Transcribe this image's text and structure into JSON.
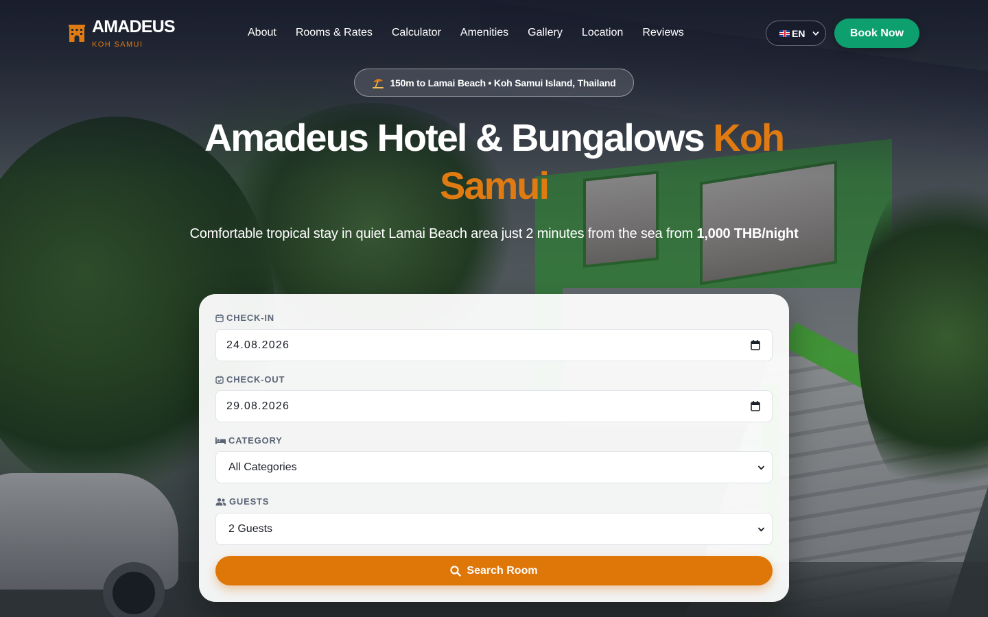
{
  "header": {
    "logo_name": "AMADEUS",
    "logo_sub": "KOH SAMUI",
    "nav": [
      "About",
      "Rooms & Rates",
      "Calculator",
      "Amenities",
      "Gallery",
      "Location",
      "Reviews"
    ],
    "language": "EN",
    "book_now": "Book Now"
  },
  "hero": {
    "location_badge": "150m to Lamai Beach • Koh Samui Island, Thailand",
    "title_main": "Amadeus Hotel & Bungalows",
    "title_accent": "Koh Samui",
    "subtitle_text": "Comfortable tropical stay in quiet Lamai Beach area just 2 minutes from the sea from",
    "subtitle_price": "1,000 THB/night"
  },
  "booking": {
    "checkin_label": "CHECK-IN",
    "checkin_value": "24.08.2026",
    "checkout_label": "CHECK-OUT",
    "checkout_value": "29.08.2026",
    "category_label": "CATEGORY",
    "category_value": "All Categories",
    "guests_label": "GUESTS",
    "guests_value": "2 Guests",
    "search_label": "Search Room"
  },
  "colors": {
    "accent": "#e07b12",
    "book_button": "#0e9f6e",
    "search_button": "#df7608"
  },
  "icons": {
    "logo": "hotel-building-icon",
    "badge": "beach-umbrella-icon",
    "checkin": "calendar-icon",
    "checkout": "calendar-check-icon",
    "category": "bed-icon",
    "guests": "users-icon",
    "search": "search-icon"
  }
}
